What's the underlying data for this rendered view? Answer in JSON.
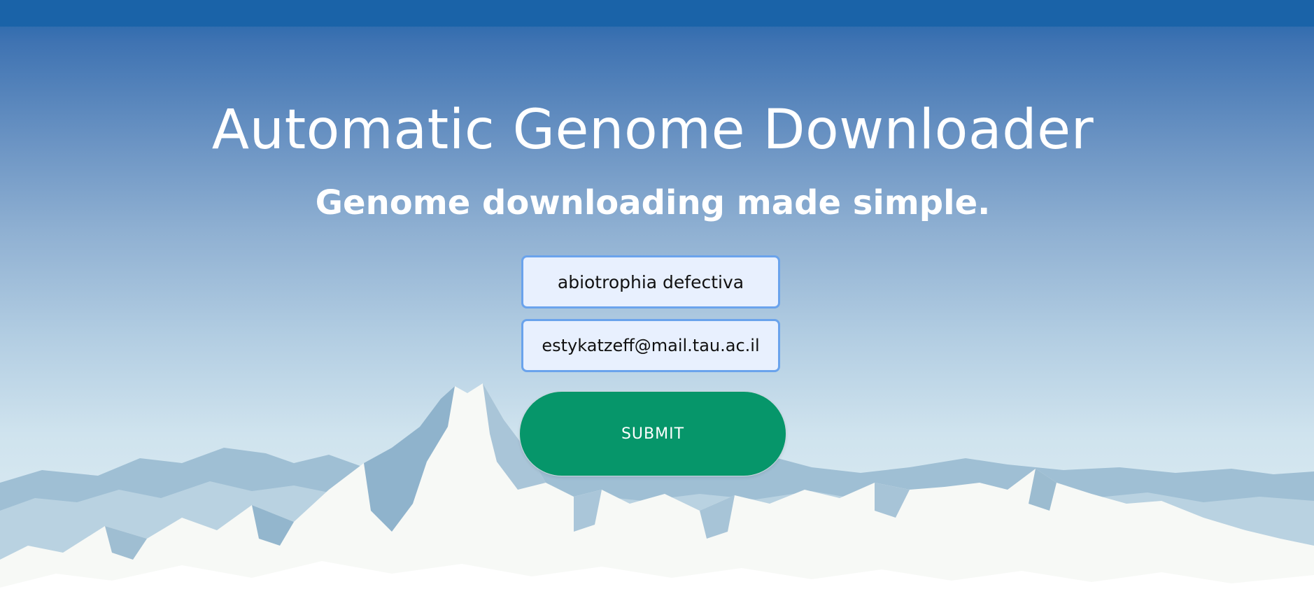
{
  "header": {
    "title": "Automatic Genome Downloader",
    "subtitle": "Genome downloading made simple."
  },
  "form": {
    "species_value": "abiotrophia defectiva",
    "email_value": "estykatzeff@mail.tau.ac.il",
    "submit_label": "SUBMIT"
  },
  "colors": {
    "accent": "#06966a",
    "input_border": "#6aa3ec",
    "input_background": "#e8f0fe",
    "sky_top": "#1c63aa"
  }
}
